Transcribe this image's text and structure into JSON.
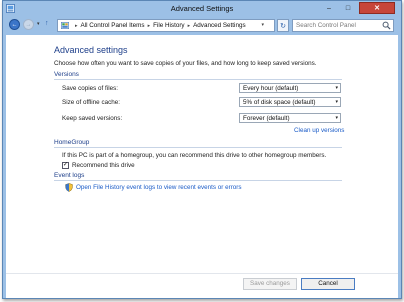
{
  "window": {
    "title": "Advanced Settings",
    "controls": {
      "minimize": "–",
      "maximize": "□",
      "close": "✕"
    }
  },
  "nav": {
    "back_icon": "←",
    "forward_icon": "→",
    "dropdown_icon": "▾",
    "up_icon": "↑",
    "refresh_icon": "↻"
  },
  "breadcrumb": [
    {
      "label": "All Control Panel Items"
    },
    {
      "label": "File History"
    },
    {
      "label": "Advanced Settings"
    }
  ],
  "breadcrumb_separator": "▸",
  "search": {
    "placeholder": "Search Control Panel"
  },
  "main": {
    "page_title": "Advanced settings",
    "description": "Choose how often you want to save copies of your files, and how long to keep saved versions.",
    "versions": {
      "heading": "Versions",
      "rows": [
        {
          "label": "Save copies of files:",
          "value": "Every hour (default)"
        },
        {
          "label": "Size of offline cache:",
          "value": "5% of disk space (default)"
        },
        {
          "label": "Keep saved versions:",
          "value": "Forever (default)"
        }
      ],
      "cleanup_link": "Clean up versions"
    },
    "homegroup": {
      "heading": "HomeGroup",
      "text": "If this PC is part of a homegroup, you can recommend this drive to other homegroup members.",
      "checkbox_label": "Recommend this drive",
      "checkbox_checked": true,
      "check_mark": "✓"
    },
    "event_logs": {
      "heading": "Event logs",
      "link": "Open File History event logs to view recent events or errors"
    }
  },
  "footer": {
    "save_label": "Save changes",
    "save_enabled": false,
    "cancel_label": "Cancel"
  },
  "colors": {
    "frame": "#9cc0e6",
    "heading": "#1e3f8a",
    "link": "#1a5bc7",
    "close_button": "#c7463a"
  }
}
